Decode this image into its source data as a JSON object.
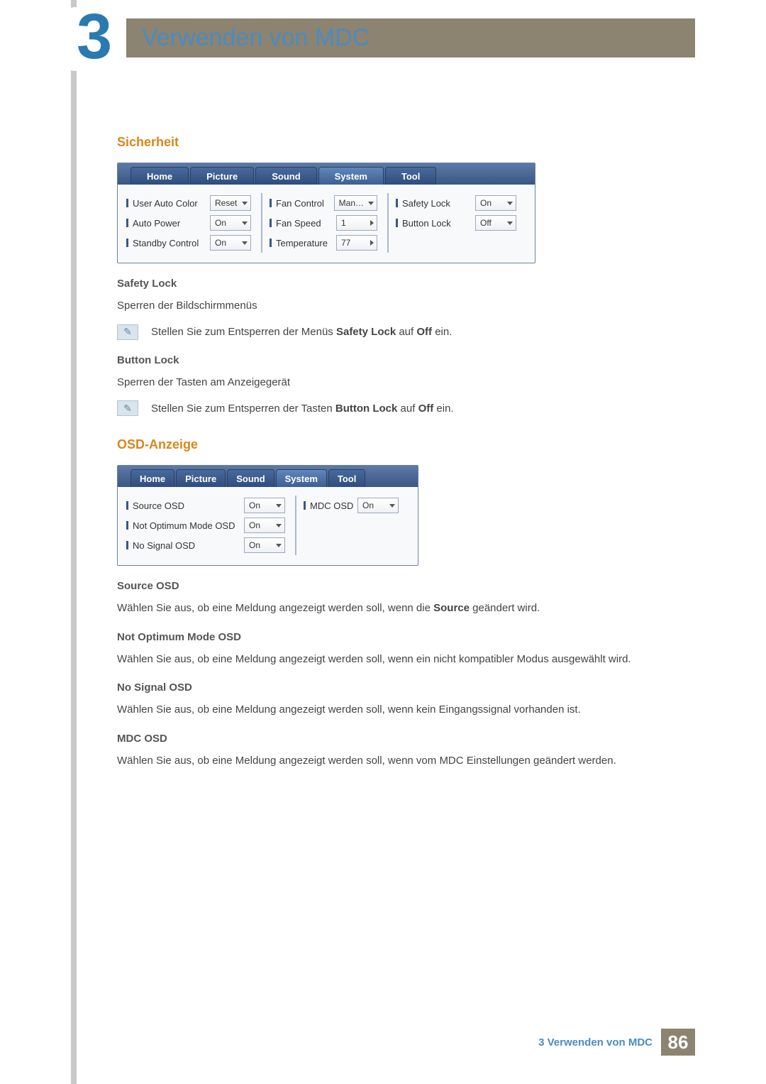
{
  "chapter": {
    "number": "3",
    "title": "Verwenden von MDC"
  },
  "sections": {
    "sicherheit": {
      "heading": "Sicherheit",
      "tabs": [
        "Home",
        "Picture",
        "Sound",
        "System",
        "Tool"
      ],
      "active_tab_index": 3,
      "columns": [
        [
          {
            "label": "User Auto Color",
            "value": "Reset",
            "control": "dropdown"
          },
          {
            "label": "Auto Power",
            "value": "On",
            "control": "dropdown"
          },
          {
            "label": "Standby Control",
            "value": "On",
            "control": "dropdown"
          }
        ],
        [
          {
            "label": "Fan Control",
            "value": "Man…",
            "control": "dropdown"
          },
          {
            "label": "Fan Speed",
            "value": "1",
            "control": "stepper"
          },
          {
            "label": "Temperature",
            "value": "77",
            "control": "stepper"
          }
        ],
        [
          {
            "label": "Safety Lock",
            "value": "On",
            "control": "dropdown"
          },
          {
            "label": "Button Lock",
            "value": "Off",
            "control": "dropdown"
          }
        ]
      ],
      "safety_lock": {
        "heading": "Safety Lock",
        "text": "Sperren der Bildschirmmenüs",
        "note_pre": "Stellen Sie zum Entsperren der Menüs ",
        "note_bold": "Safety Lock",
        "note_mid": " auf ",
        "note_bold2": "Off",
        "note_post": " ein."
      },
      "button_lock": {
        "heading": "Button Lock",
        "text": "Sperren der Tasten am Anzeigegerät",
        "note_pre": "Stellen Sie zum Entsperren der Tasten ",
        "note_bold": "Button Lock",
        "note_mid": " auf ",
        "note_bold2": "Off",
        "note_post": " ein."
      }
    },
    "osd": {
      "heading": "OSD-Anzeige",
      "tabs": [
        "Home",
        "Picture",
        "Sound",
        "System",
        "Tool"
      ],
      "active_tab_index": 3,
      "columns": [
        [
          {
            "label": "Source OSD",
            "value": "On",
            "control": "dropdown"
          },
          {
            "label": "Not Optimum Mode OSD",
            "value": "On",
            "control": "dropdown"
          },
          {
            "label": "No Signal OSD",
            "value": "On",
            "control": "dropdown"
          }
        ],
        [
          {
            "label": "MDC OSD",
            "value": "On",
            "control": "dropdown"
          }
        ]
      ],
      "items": {
        "source_osd": {
          "heading": "Source OSD",
          "text_pre": "Wählen Sie aus, ob eine Meldung angezeigt werden soll, wenn die ",
          "text_bold": "Source",
          "text_post": " geändert wird."
        },
        "not_optimum": {
          "heading": "Not Optimum Mode OSD",
          "text": "Wählen Sie aus, ob eine Meldung angezeigt werden soll, wenn ein nicht kompatibler Modus ausgewählt wird."
        },
        "no_signal": {
          "heading": "No Signal OSD",
          "text": "Wählen Sie aus, ob eine Meldung angezeigt werden soll, wenn kein Eingangssignal vorhanden ist."
        },
        "mdc_osd": {
          "heading": "MDC OSD",
          "text": "Wählen Sie aus, ob eine Meldung angezeigt werden soll, wenn vom MDC Einstellungen geändert werden."
        }
      }
    }
  },
  "footer": {
    "text": "3 Verwenden von MDC",
    "page": "86"
  }
}
